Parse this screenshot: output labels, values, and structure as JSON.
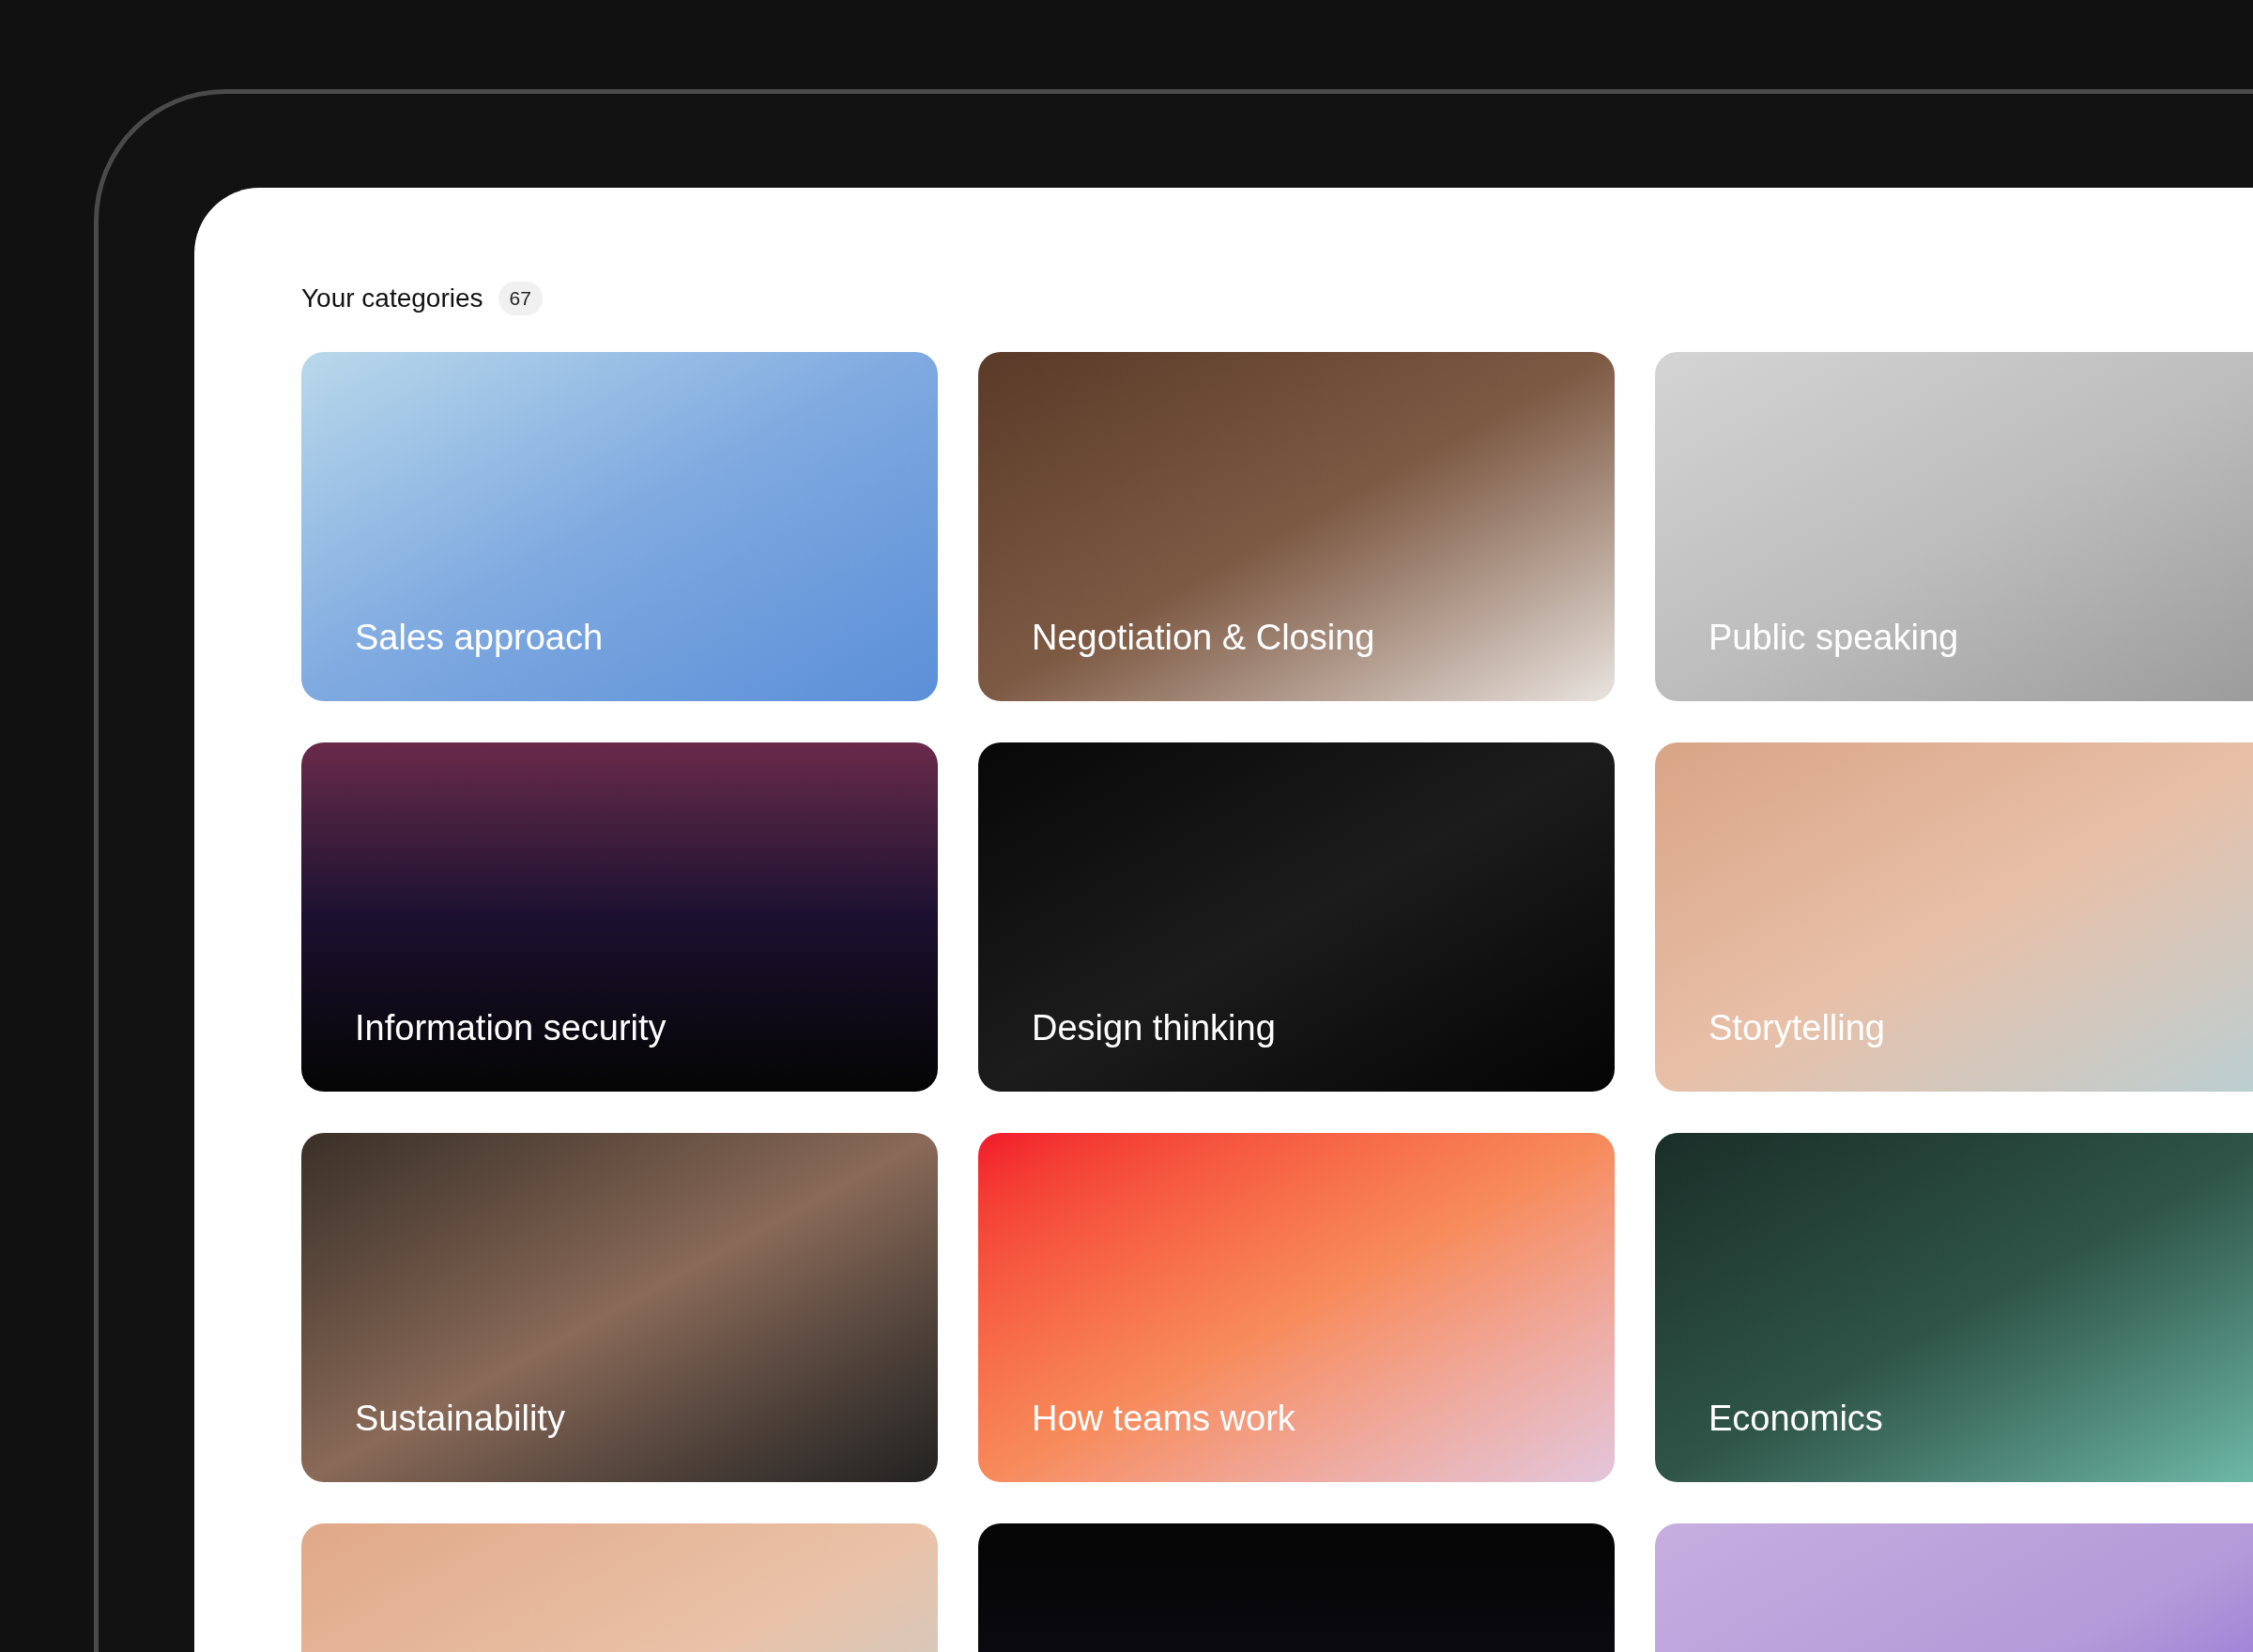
{
  "header": {
    "title": "Your categories",
    "count": "67"
  },
  "cards": [
    {
      "kind": "labeled",
      "label": "Sales approach"
    },
    {
      "kind": "labeled",
      "label": "Negotiation & Closing"
    },
    {
      "kind": "labeled",
      "label": "Public speaking"
    },
    {
      "kind": "labeled",
      "label": "Information security"
    },
    {
      "kind": "labeled",
      "label": "Design thinking"
    },
    {
      "kind": "labeled",
      "label": "Storytelling"
    },
    {
      "kind": "labeled",
      "label": "Sustainability"
    },
    {
      "kind": "labeled",
      "label": "How teams work"
    },
    {
      "kind": "labeled",
      "label": "Economics"
    },
    {
      "kind": "cut"
    },
    {
      "kind": "cut"
    },
    {
      "kind": "cut"
    }
  ]
}
